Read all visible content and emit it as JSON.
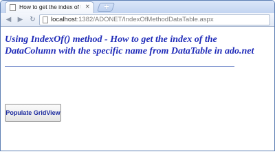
{
  "browser": {
    "tab": {
      "title": "How to get the index of t...",
      "close_glyph": "×"
    },
    "new_tab_glyph": "+",
    "nav": {
      "back_glyph": "◀",
      "forward_glyph": "▶",
      "reload_glyph": "↻"
    },
    "address": {
      "host": "localhost",
      "rest": ":1382/ADONET/IndexOfMethodDataTable.aspx"
    }
  },
  "page": {
    "heading": "Using IndexOf() method - How to get the index of the DataColumn with the specific name from DataTable in ado.net",
    "button_label": "Populate GridView"
  },
  "colors": {
    "heading": "#1f2bb8",
    "divider": "#6d86c9",
    "button_text": "#1b2a9e"
  },
  "icons": [
    "page-icon",
    "back-arrow-icon",
    "forward-arrow-icon",
    "reload-icon",
    "close-icon",
    "plus-icon"
  ]
}
